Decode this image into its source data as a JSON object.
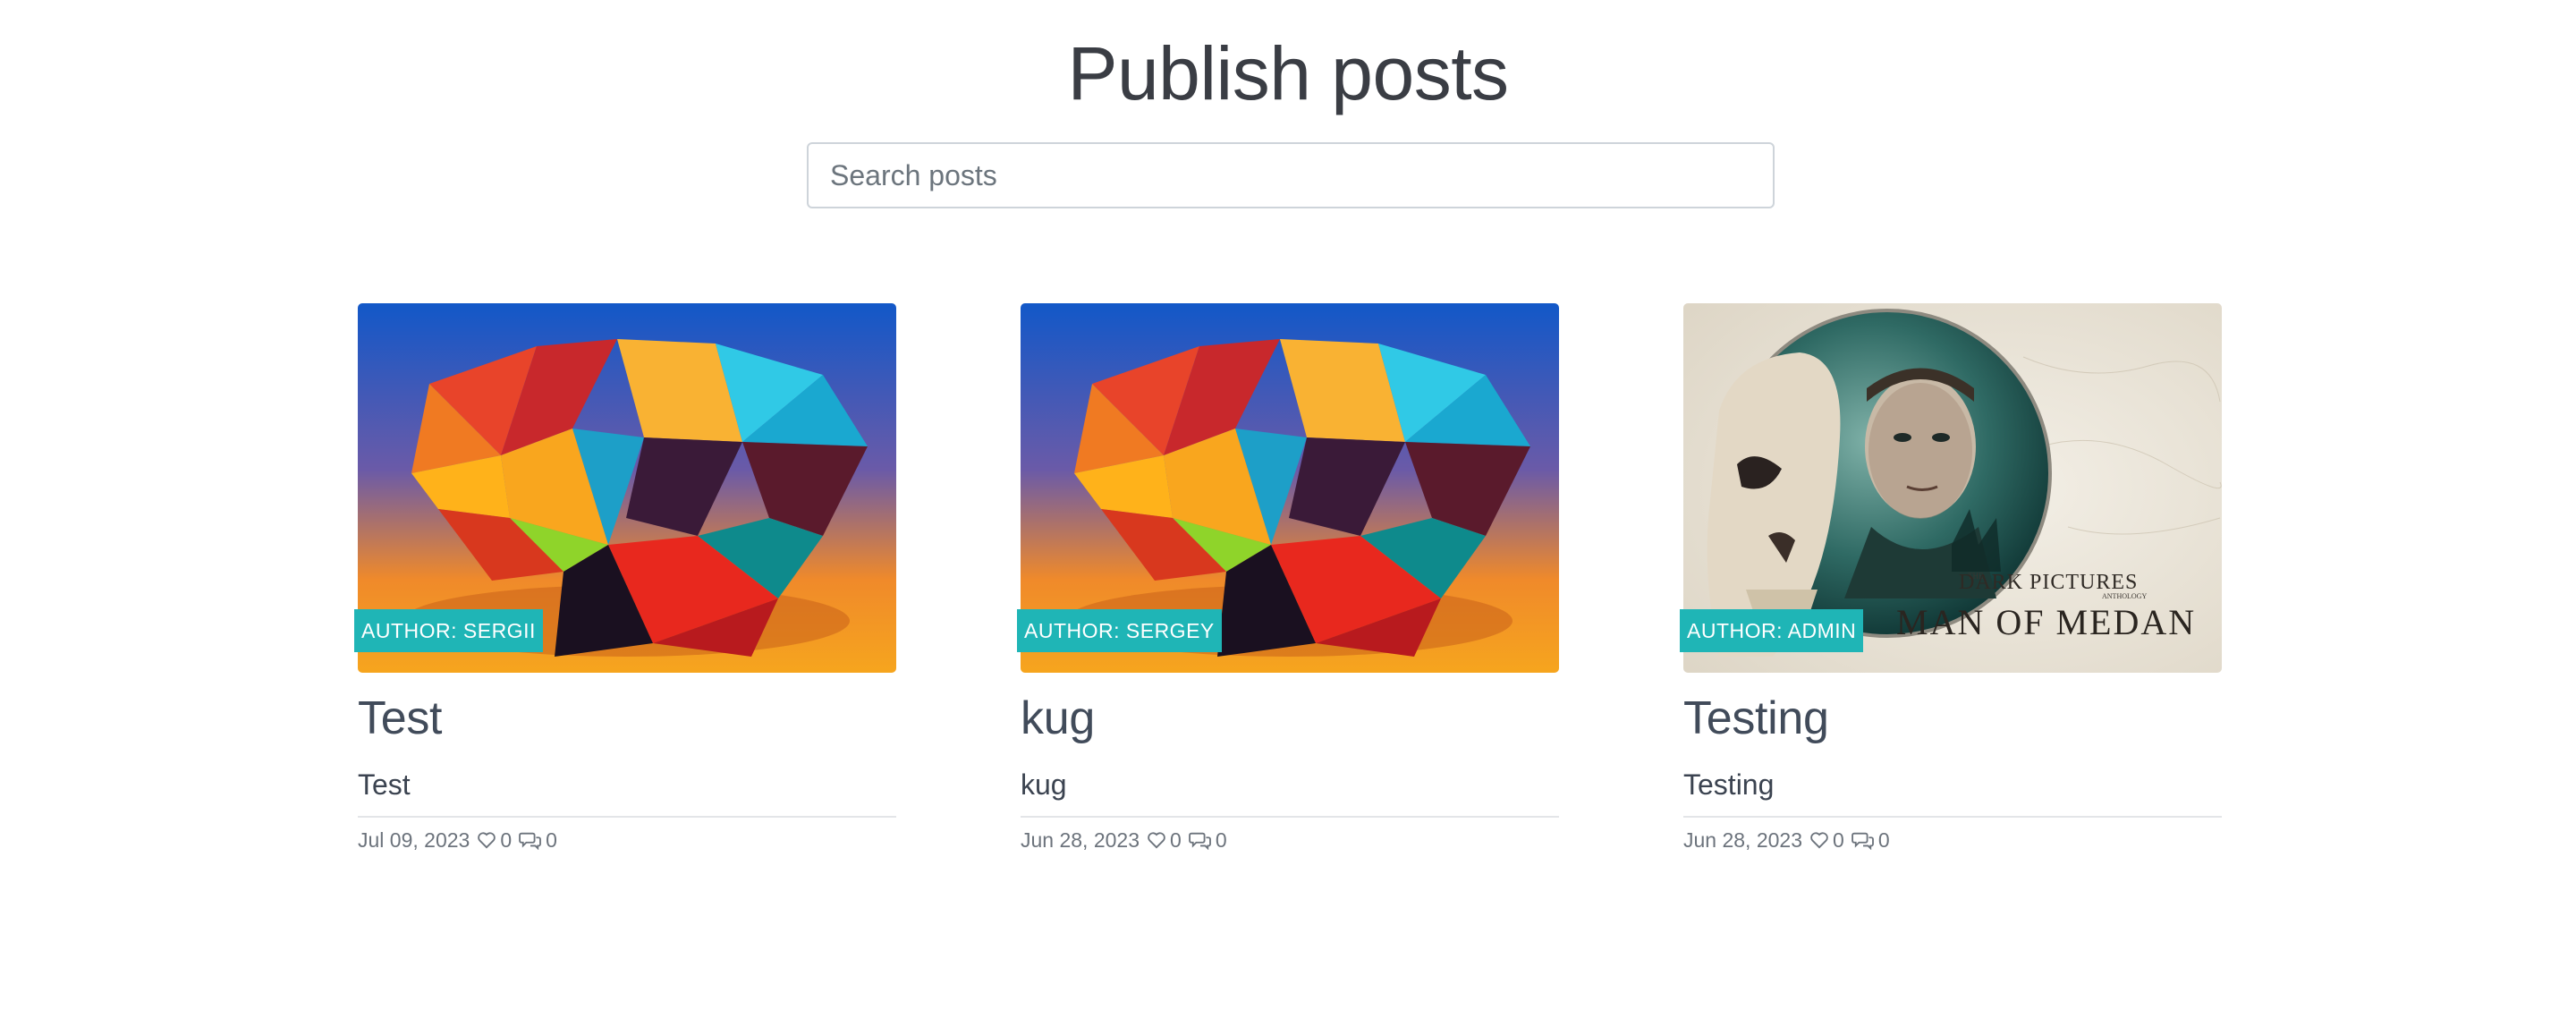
{
  "page": {
    "title": "Publish posts"
  },
  "search": {
    "placeholder": "Search posts",
    "value": ""
  },
  "posts": [
    {
      "author_badge": "AUTHOR: SERGII",
      "image": "origami-colorful-polyhedron",
      "title": "Test",
      "excerpt": "Test",
      "date": "Jul 09, 2023",
      "likes": "0",
      "comments": "0"
    },
    {
      "author_badge": "AUTHOR: SERGEY",
      "image": "origami-colorful-polyhedron",
      "title": "kug",
      "excerpt": "kug",
      "date": "Jun 28, 2023",
      "likes": "0",
      "comments": "0"
    },
    {
      "author_badge": "AUTHOR: ADMIN",
      "image": "dark-pictures-man-of-medan-cover",
      "image_text": {
        "line1": "THE",
        "line2": "DARK PICTURES",
        "line3": "ANTHOLOGY",
        "line4": "MAN OF MEDAN"
      },
      "title": "Testing",
      "excerpt": "Testing",
      "date": "Jun 28, 2023",
      "likes": "0",
      "comments": "0"
    }
  ],
  "icons": {
    "like": "heart-icon",
    "comment": "comments-icon"
  },
  "colors": {
    "badge": "#1fb5b6",
    "title": "#414b5a",
    "meta": "#6c737c",
    "divider": "#e3e5e8"
  }
}
